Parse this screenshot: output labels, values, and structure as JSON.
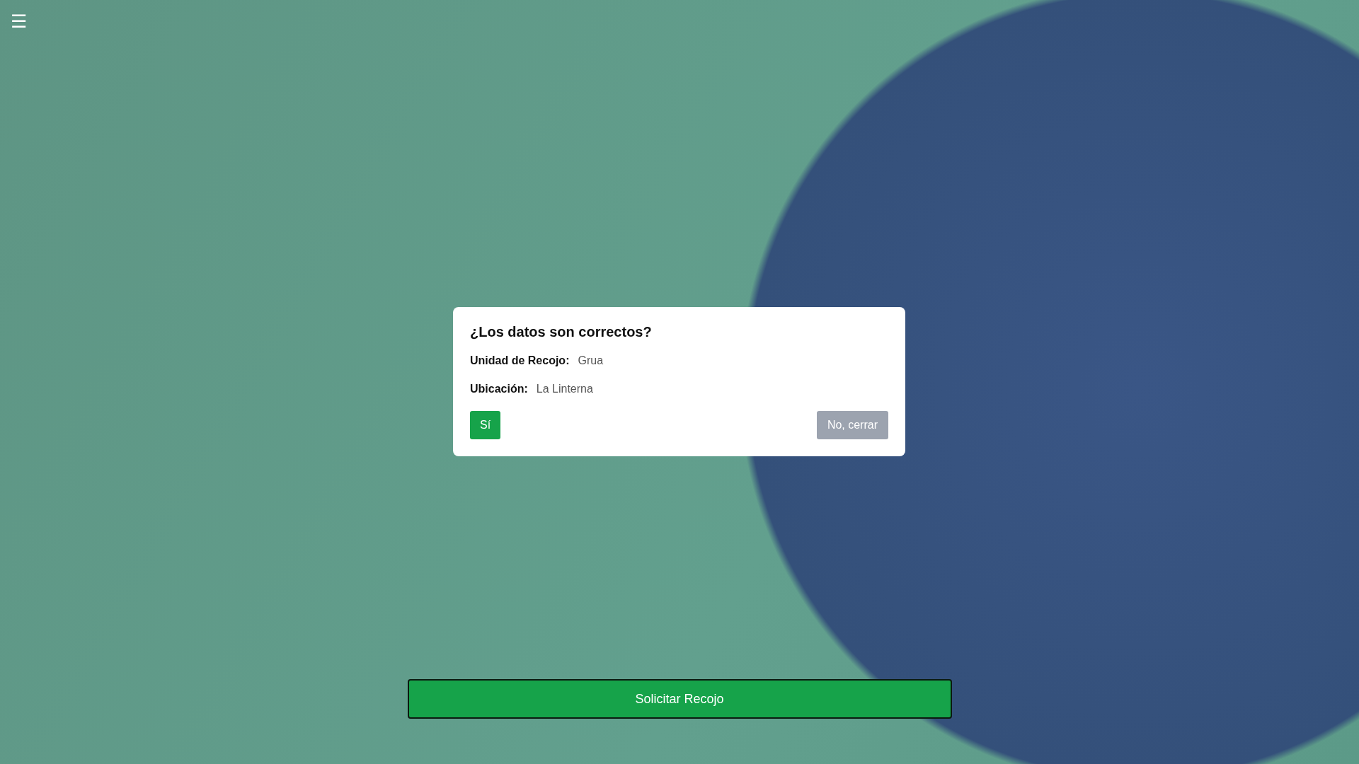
{
  "menu_button": {
    "icon": "☰"
  },
  "dialog": {
    "title": "¿Los datos son correctos?",
    "fields": [
      {
        "label": "Unidad de Recojo:",
        "value": "Grua"
      },
      {
        "label": "Ubicación:",
        "value": "La Linterna"
      }
    ],
    "confirm_button": "Sí",
    "cancel_button": "No, cerrar"
  },
  "request_button": "Solicitar Recojo"
}
